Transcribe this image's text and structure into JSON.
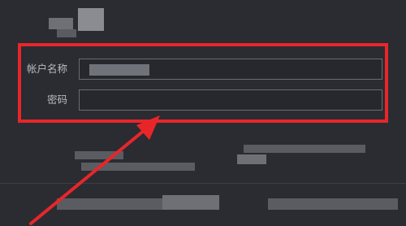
{
  "form": {
    "account_label": "帐户名称",
    "account_value": "",
    "password_label": "密码",
    "password_value": ""
  },
  "annotation": {
    "color": "#e8262a"
  }
}
